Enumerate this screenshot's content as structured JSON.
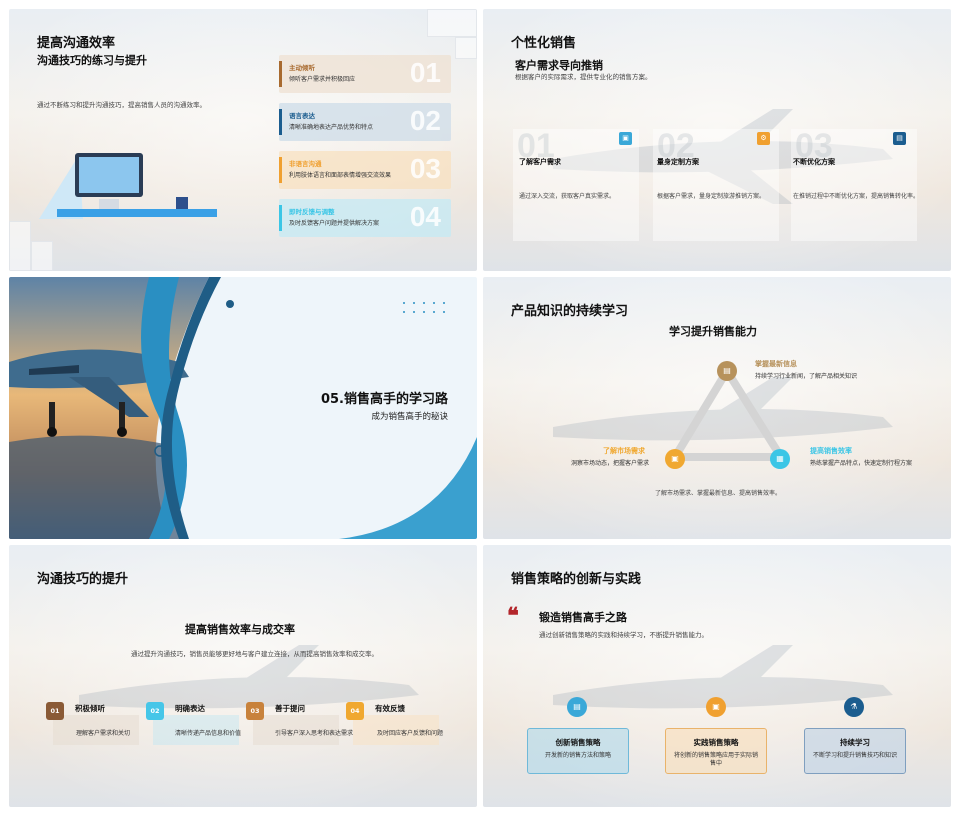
{
  "slide1": {
    "title": "提高沟通效率",
    "subtitle": "沟通技巧的练习与提升",
    "desc": "通过不断练习和提升沟通技巧，提高销售人员的沟通效率。",
    "items": [
      {
        "title": "主动倾听",
        "desc": "倾听客户需求并积极回应",
        "num": "01",
        "color": "#a86a2f"
      },
      {
        "title": "语言表达",
        "desc": "清晰准确地表达产品优势和特点",
        "num": "02",
        "color": "#1b5d8f"
      },
      {
        "title": "非语言沟通",
        "desc": "利用肢体语言和面部表情增强交流效果",
        "num": "03",
        "color": "#f0a030"
      },
      {
        "title": "即时反馈与调整",
        "desc": "及时反馈客户问题并提供解决方案",
        "num": "04",
        "color": "#3bc6e6"
      }
    ]
  },
  "slide2": {
    "title": "个性化销售",
    "subtitle": "客户需求导向推销",
    "desc": "根据客户的实际需求，提供专业化的销售方案。",
    "cards": [
      {
        "num": "01",
        "title": "了解客户需求",
        "desc": "通过深入交流，获取客户真实需求。",
        "color": "#3aa8d8",
        "icon": "▣"
      },
      {
        "num": "02",
        "title": "量身定制方案",
        "desc": "根据客户需求，量身定制旅游推销方案。",
        "color": "#f0a030",
        "icon": "⚙"
      },
      {
        "num": "03",
        "title": "不断优化方案",
        "desc": "在推销过程中不断优化方案，提高销售转化率。",
        "color": "#1b5d8f",
        "icon": "▤"
      }
    ]
  },
  "slide3": {
    "title": "05.销售高手的学习路",
    "subtitle": "成为销售高手的秘诀"
  },
  "slide4": {
    "title": "产品知识的持续学习",
    "subtitle": "学习提升销售能力",
    "top": {
      "title": "掌握最新信息",
      "desc": "持续学习行业新闻，了解产品相关知识"
    },
    "left": {
      "title": "了解市场需求",
      "desc": "洞察市场动态，把握客户需求"
    },
    "right": {
      "title": "提高销售效率",
      "desc": "熟练掌握产品特点，快速定制行程方案"
    },
    "bottom": "了解市场需求、掌握最新信息、提高销售效率。"
  },
  "slide5": {
    "title": "沟通技巧的提升",
    "subtitle": "提高销售效率与成交率",
    "desc": "通过提升沟通技巧，销售员能够更好地与客户建立连接，从而提高销售效率和成交率。",
    "items": [
      {
        "num": "01",
        "title": "积极倾听",
        "desc": "理解客户需求和关切",
        "color": "#8a5a36"
      },
      {
        "num": "02",
        "title": "明确表达",
        "desc": "清晰传递产品信息和价值",
        "color": "#46c6e8"
      },
      {
        "num": "03",
        "title": "善于提问",
        "desc": "引导客户深入思考和表达需求",
        "color": "#c8823c"
      },
      {
        "num": "04",
        "title": "有效反馈",
        "desc": "及时回应客户反馈和问题",
        "color": "#f0a830"
      }
    ]
  },
  "slide6": {
    "title": "销售策略的创新与实践",
    "quote_title": "锻造销售高手之路",
    "desc": "通过创新销售策略的实践和持续学习，不断提升销售能力。",
    "quote_mark": "❝",
    "boxes": [
      {
        "title": "创新销售策略",
        "desc": "开发新的销售方法和策略",
        "color": "#3aa8d8",
        "bg": "rgba(170,215,235,0.55)",
        "border": "#6fb9d9",
        "icon": "▤"
      },
      {
        "title": "实践销售策略",
        "desc": "将创新的销售策略应用于实际销售中",
        "color": "#f0a030",
        "bg": "rgba(250,220,180,0.55)",
        "border": "#e9b36a",
        "icon": "▣"
      },
      {
        "title": "持续学习",
        "desc": "不断学习和提升销售技巧和知识",
        "color": "#1b5d8f",
        "bg": "rgba(190,210,230,0.6)",
        "border": "#7f9fbf",
        "icon": "⚗"
      }
    ]
  }
}
